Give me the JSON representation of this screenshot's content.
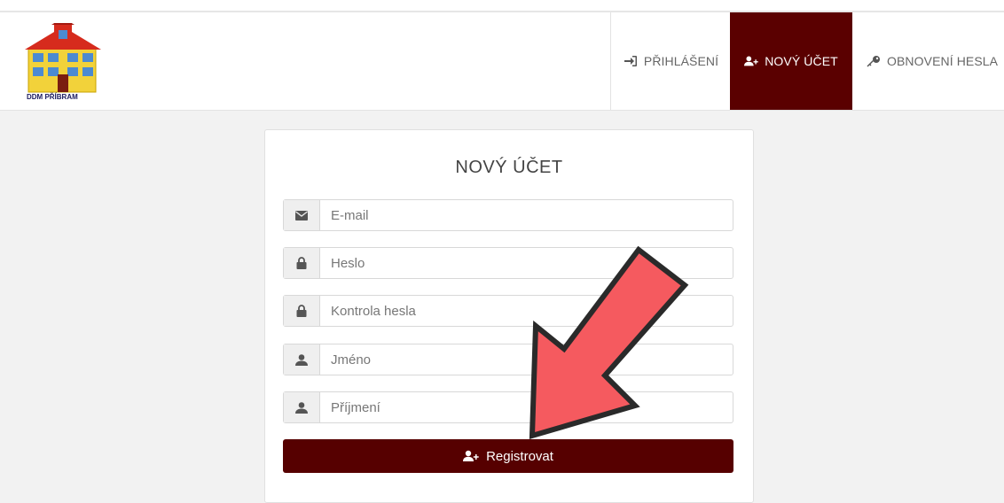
{
  "logo": {
    "text": "DDM PŘÍBRAM"
  },
  "nav": {
    "login_label": "PŘIHLÁŠENÍ",
    "new_account_label": "NOVÝ ÚČET",
    "reset_label": "OBNOVENÍ HESLA"
  },
  "form": {
    "title": "NOVÝ ÚČET",
    "email_placeholder": "E-mail",
    "password_placeholder": "Heslo",
    "password_confirm_placeholder": "Kontrola hesla",
    "first_name_placeholder": "Jméno",
    "last_name_placeholder": "Příjmení",
    "register_label": "Registrovat"
  },
  "colors": {
    "brand": "#5a0000",
    "arrow_fill": "#f55a5f",
    "arrow_outline": "#2a2a2a"
  }
}
